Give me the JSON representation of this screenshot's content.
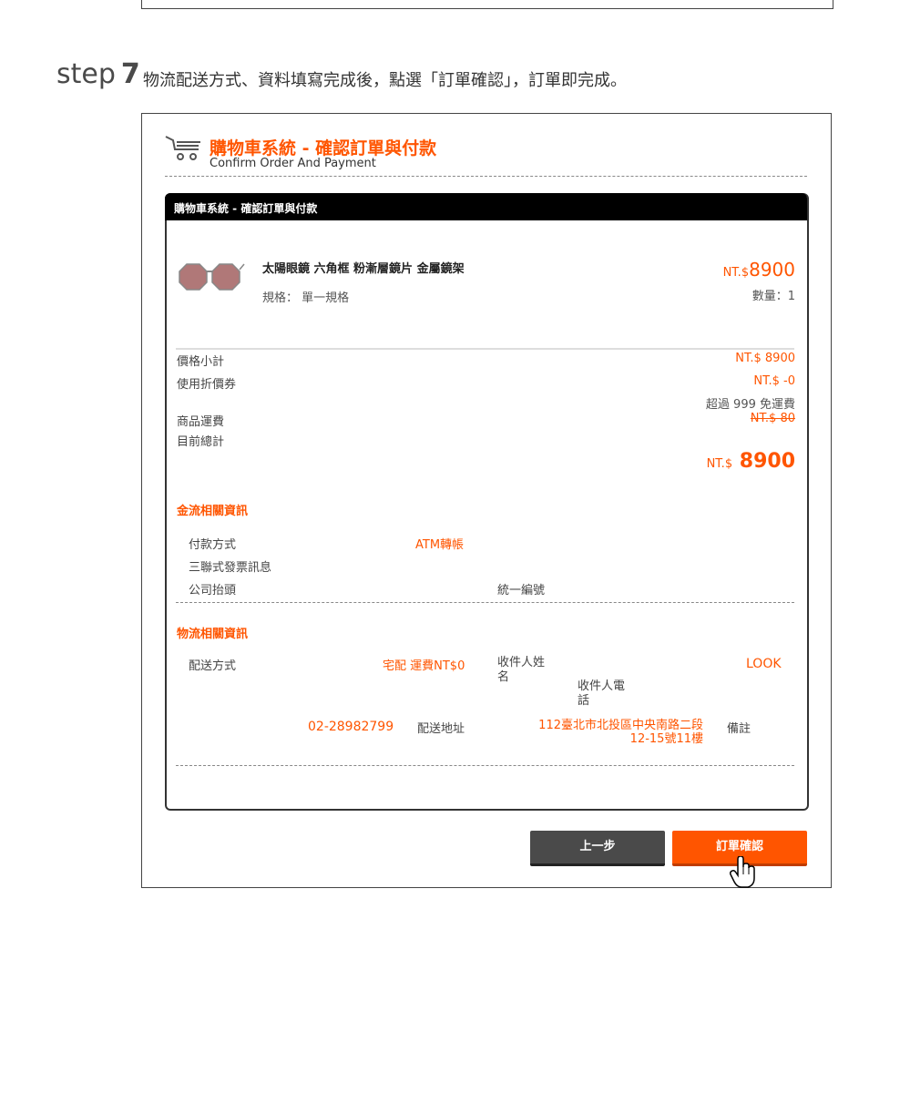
{
  "step": {
    "label": "step",
    "number": "7",
    "description": "物流配送方式、資料填寫完成後，點選「訂單確認」，訂單即完成。"
  },
  "header": {
    "title": "購物車系統 - 確認訂單與付款",
    "subtitle": "Confirm Order And Payment",
    "icon": "shopping-cart-icon"
  },
  "panel": {
    "title": "購物車系統 - 確認訂單與付款"
  },
  "product": {
    "name": "太陽眼鏡 六角框 粉漸層鏡片 金屬鏡架",
    "spec": "規格： 單一規格",
    "price_prefix": "NT.$",
    "price": "8900",
    "quantity": "數量：1"
  },
  "summary": {
    "subtotal_label": "價格小計",
    "subtotal_value": "NT.$ 8900",
    "coupon_label": "使用折價券",
    "coupon_value": "NT.$ -0",
    "free_shipping_note": "超過 999 免運費",
    "shipping_label": "商品運費",
    "shipping_value": "NT.$ 80",
    "total_label": "目前總計",
    "total_prefix": "NT.$",
    "total_value": "8900"
  },
  "payment": {
    "section_title": "金流相關資訊",
    "method_label": "付款方式",
    "method_value": "ATM轉帳",
    "invoice_label": "三聯式發票訊息",
    "company_label": "公司抬頭",
    "tax_id_label": "統一編號"
  },
  "logistics": {
    "section_title": "物流相關資訊",
    "delivery_label": "配送方式",
    "delivery_value": "宅配 運費NT$0",
    "recipient_name_label": "收件人姓名",
    "recipient_name_value": "LOOK",
    "recipient_phone_label": "收件人電話",
    "recipient_phone_value": "02-28982799",
    "address_label": "配送地址",
    "address_value_1": "112臺北市北投區中央南路二段",
    "address_value_2": "12-15號11樓",
    "note_label": "備註"
  },
  "buttons": {
    "prev": "上一步",
    "confirm": "訂單確認"
  },
  "colors": {
    "accent": "#ff5500",
    "dark": "#4a4a4a",
    "header": "#000000"
  }
}
